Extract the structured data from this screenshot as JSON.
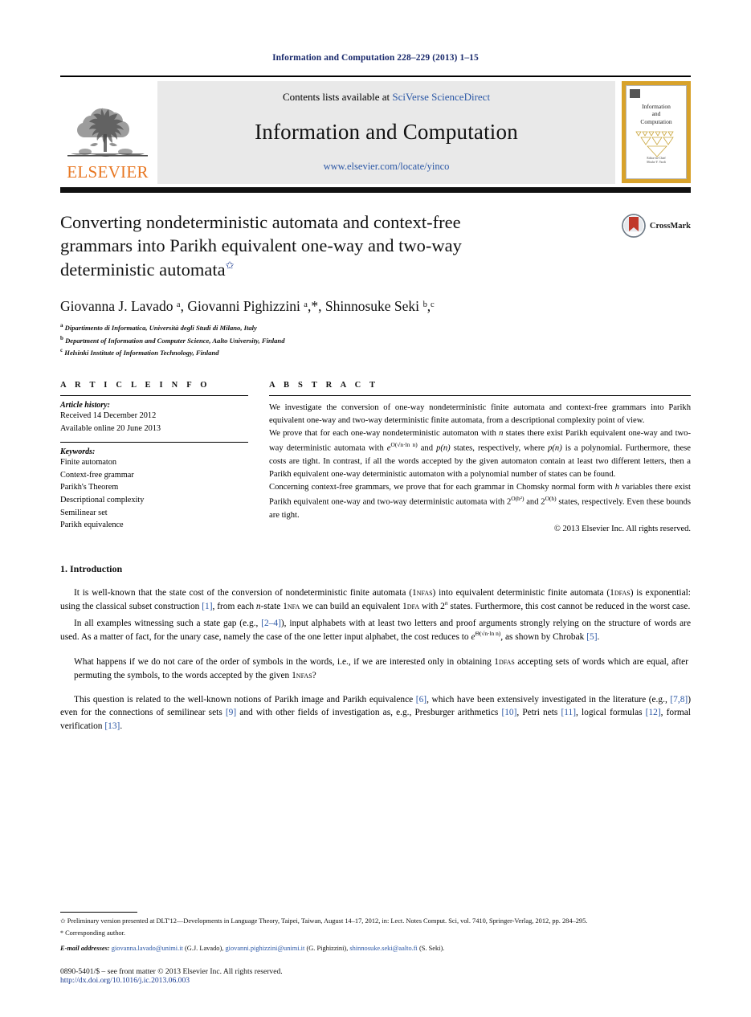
{
  "running_head": "Information and Computation 228–229 (2013) 1–15",
  "masthead": {
    "publisher_name": "ELSEVIER",
    "contents_prefix": "Contents lists available at",
    "contents_link": "SciVerse ScienceDirect",
    "journal_title": "Information and Computation",
    "journal_url": "www.elsevier.com/locate/yinco",
    "cover_title_line1": "Information",
    "cover_title_line2": "and",
    "cover_title_line3": "Computation",
    "cover_footer_line1": "Editor-in-Chief",
    "cover_footer_line2": "Moshe Y. Vardi"
  },
  "badge": {
    "crossmark_label": "CrossMark"
  },
  "article": {
    "title_line1": "Converting nondeterministic automata and context-free",
    "title_line2": "grammars into Parikh equivalent one-way and two-way",
    "title_line3": "deterministic automata",
    "title_footnote_marker": "✩",
    "authors": "Giovanna J. Lavado ᵃ, Giovanni Pighizzini ᵃ,*, Shinnosuke Seki ᵇ,ᶜ",
    "affiliations": [
      {
        "marker": "a",
        "text": "Dipartimento di Informatica, Università degli Studi di Milano, Italy"
      },
      {
        "marker": "b",
        "text": "Department of Information and Computer Science, Aalto University, Finland"
      },
      {
        "marker": "c",
        "text": "Helsinki Institute of Information Technology, Finland"
      }
    ]
  },
  "info": {
    "heading": "A R T I C L E   I N F O",
    "history_label": "Article history:",
    "history_lines": [
      "Received 14 December 2012",
      "Available online 20 June 2013"
    ],
    "keywords_label": "Keywords:",
    "keywords": [
      "Finite automaton",
      "Context-free grammar",
      "Parikh's Theorem",
      "Descriptional complexity",
      "Semilinear set",
      "Parikh equivalence"
    ]
  },
  "abstract": {
    "heading": "A B S T R A C T",
    "paragraph1": "We investigate the conversion of one-way nondeterministic finite automata and context-free grammars into Parikh equivalent one-way and two-way deterministic finite automata, from a descriptional complexity point of view.",
    "paragraph2_a": "We prove that for each one-way nondeterministic automaton with ",
    "paragraph2_b": " states there exist Parikh equivalent one-way and two-way deterministic automata with ",
    "paragraph2_c": " and ",
    "paragraph2_d": " states, respectively, where ",
    "paragraph2_e": " is a polynomial. Furthermore, these costs are tight. In contrast, if all the words accepted by the given automaton contain at least two different letters, then a Parikh equivalent one-way deterministic automaton with a polynomial number of states can be found.",
    "paragraph3_a": "Concerning context-free grammars, we prove that for each grammar in Chomsky normal form with ",
    "paragraph3_b": " variables there exist Parikh equivalent one-way and two-way deterministic automata with ",
    "paragraph3_c": " and ",
    "paragraph3_d": " states, respectively. Even these bounds are tight.",
    "math_n": "n",
    "math_h": "h",
    "math_exp_sqrt": "e",
    "math_exp_sqrt_sup": "O(√n·ln n)",
    "math_pn": "p(n)",
    "math_two": "2",
    "math_two_sup_h2": "O(h²)",
    "math_two_sup_h": "O(h)",
    "copyright": "© 2013 Elsevier Inc. All rights reserved."
  },
  "body": {
    "section_number_title": "1. Introduction",
    "p1_parts": {
      "a": "It is well-known that the state cost of the conversion of nondeterministic finite automata (1",
      "sc1": "nfas",
      "b": ") into equivalent deterministic finite automata (1",
      "sc2": "dfas",
      "c": ") is exponential: using the classical subset construction ",
      "cit1": "[1]",
      "d": ", from each ",
      "mi1": "n",
      "e": "-state 1",
      "sc3": "nfa",
      "f": " we can build an equivalent 1",
      "sc4": "dfa",
      "g": " with 2",
      "sup1": "n",
      "h": " states. Furthermore, this cost cannot be reduced in the worst case."
    },
    "p2_parts": {
      "a": "In all examples witnessing such a state gap (e.g., ",
      "cit1": "[2–4]",
      "b": "), input alphabets with at least two letters and proof arguments strongly relying on the structure of words are used. As a matter of fact, for the unary case, namely the case of the one letter input alphabet, the cost reduces to ",
      "math": "e",
      "math_sup": "Θ(√n·ln n)",
      "c": ", as shown by Chrobak ",
      "cit2": "[5]",
      "d": "."
    },
    "p3_parts": {
      "a": "What happens if we do not care of the order of symbols in the words, i.e., if we are interested only in obtaining 1",
      "sc1": "dfas",
      "b": " accepting sets of words which are equal, after permuting the symbols, to the words accepted by the given 1",
      "sc2": "nfas",
      "c": "?"
    },
    "p4_parts": {
      "a": "This question is related to the well-known notions of Parikh image and Parikh equivalence ",
      "cit1": "[6]",
      "b": ", which have been extensively investigated in the literature (e.g., ",
      "cit2": "[7,8]",
      "c": ") even for the connections of semilinear sets ",
      "cit3": "[9]",
      "d": " and with other fields of investigation as, e.g., Presburger arithmetics ",
      "cit4": "[10]",
      "e": ", Petri nets ",
      "cit5": "[11]",
      "f": ", logical formulas ",
      "cit6": "[12]",
      "g": ", formal verification ",
      "cit7": "[13]",
      "h": "."
    }
  },
  "footnotes": {
    "star_marker": "✩",
    "star_text": "Preliminary version presented at DLT'12—Developments in Language Theory, Taipei, Taiwan, August 14–17, 2012, in: Lect. Notes Comput. Sci, vol. 7410, Springer-Verlag, 2012, pp. 284–295.",
    "corresponding_marker": "*",
    "corresponding_text": "Corresponding author.",
    "email_label": "E-mail addresses:",
    "emails": [
      {
        "address": "giovanna.lavado@unimi.it",
        "owner": "(G.J. Lavado)"
      },
      {
        "address": "giovanni.pighizzini@unimi.it",
        "owner": "(G. Pighizzini)"
      },
      {
        "address": "shinnosuke.seki@aalto.fi",
        "owner": "(S. Seki)"
      }
    ]
  },
  "imprint": {
    "line1": "0890-5401/$ – see front matter  © 2013 Elsevier Inc. All rights reserved.",
    "doi": "http://dx.doi.org/10.1016/j.ic.2013.06.003"
  },
  "colors": {
    "link_blue": "#2b57a5",
    "heading_blue": "#1a2a6c",
    "elsevier_orange": "#E87722",
    "banner_gray": "#e9e9e9",
    "cover_gold": "#d8a22a"
  }
}
